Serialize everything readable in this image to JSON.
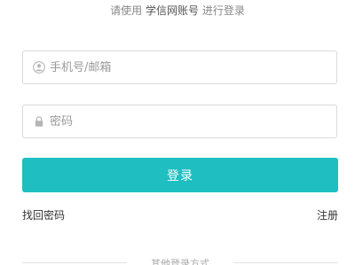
{
  "header": {
    "prefix": "请使用",
    "brand": "学信网账号",
    "suffix": "进行登录"
  },
  "form": {
    "username_placeholder": "手机号/邮箱",
    "username_value": "",
    "username_icon": "user-circle-icon",
    "password_placeholder": "密码",
    "password_value": "",
    "password_icon": "lock-icon",
    "login_label": "登录"
  },
  "links": {
    "forgot_password": "找回密码",
    "register": "注册"
  },
  "other_login": {
    "label": "其他登录方式"
  },
  "colors": {
    "accent": "#1fbfc1",
    "border": "#d9d9d9",
    "muted_text": "#888888"
  }
}
